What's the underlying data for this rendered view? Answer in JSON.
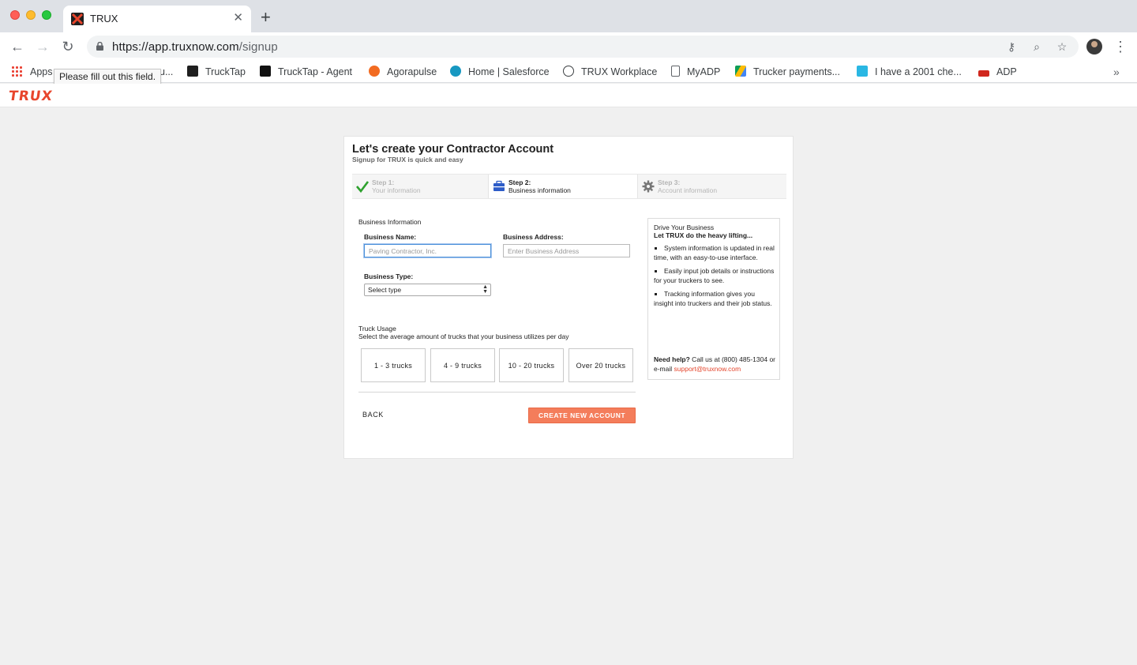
{
  "browser": {
    "tab_title": "TRUX",
    "url_host": "https://app.truxnow.com",
    "url_path": "/signup",
    "bookmarks": [
      {
        "label": "Apps"
      },
      {
        "label": "u..."
      },
      {
        "label": "TruckTap"
      },
      {
        "label": "TruckTap - Agent"
      },
      {
        "label": "Agorapulse"
      },
      {
        "label": "Home | Salesforce"
      },
      {
        "label": "TRUX Workplace"
      },
      {
        "label": "MyADP"
      },
      {
        "label": "Trucker payments..."
      },
      {
        "label": "I have a 2001 che..."
      },
      {
        "label": "ADP"
      }
    ],
    "tooltip": "Please fill out this field."
  },
  "app": {
    "brand": "TRUX",
    "brand_color": "#e8452c"
  },
  "form": {
    "title": "Let's create your Contractor Account",
    "subtitle": "Signup for TRUX is quick and easy",
    "steps": [
      {
        "name": "Step 1:",
        "desc": "Your information",
        "state": "complete",
        "icon": "check-icon"
      },
      {
        "name": "Step 2:",
        "desc": "Business information",
        "state": "active",
        "icon": "briefcase-icon"
      },
      {
        "name": "Step 3:",
        "desc": "Account information",
        "state": "pending",
        "icon": "gear-icon"
      }
    ],
    "section_label": "Business Information",
    "business_name": {
      "label": "Business Name:",
      "placeholder": "Paving Contractor, Inc.",
      "value": ""
    },
    "business_address": {
      "label": "Business Address:",
      "placeholder": "Enter Business Address",
      "value": ""
    },
    "business_type": {
      "label": "Business Type:",
      "selected": "Select type"
    },
    "truck_usage": {
      "title": "Truck Usage",
      "description": "Select the average amount of trucks that your business utilizes per day",
      "options": [
        "1 - 3 trucks",
        "4 - 9 trucks",
        "10 - 20 trucks",
        "Over 20 trucks"
      ]
    },
    "back_label": "BACK",
    "create_label": "CREATE NEW ACCOUNT",
    "create_color": "#f47d5b"
  },
  "sidebar": {
    "title": "Drive Your Business",
    "subtitle": "Let TRUX do the heavy lifting...",
    "bullets": [
      "System information is updated in real time, with an easy-to-use interface.",
      "Easily input job details or instructions for your truckers to see.",
      "Tracking information gives you insight into truckers and their job status."
    ],
    "help_bold": "Need help?",
    "help_text_1": " Call us at (800) 485-1304 or e-mail ",
    "help_email": "support@truxnow.com"
  }
}
